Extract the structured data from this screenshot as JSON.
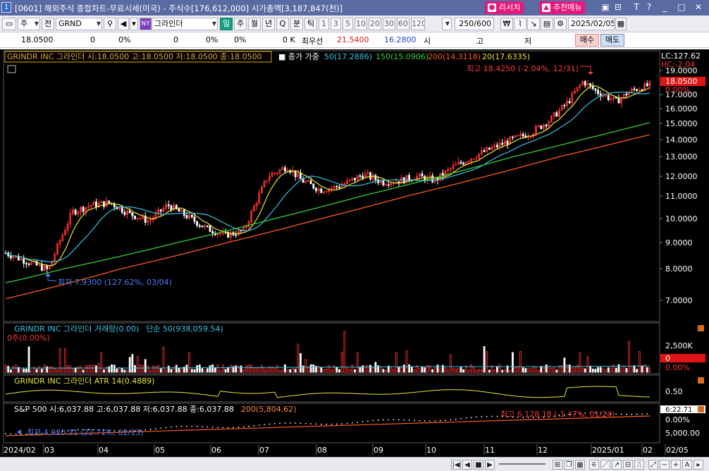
{
  "window": {
    "number": "1",
    "title": "[0601] 해외주식 종합차트-무료시세(미국) - 주식수[176,612,000] 시가총액[3,187,847(천)]",
    "research_label": "리서치",
    "menu_label": "추천메뉴",
    "controls": [
      "▣",
      "⊟",
      "T",
      "?",
      "_",
      "□",
      "✕"
    ]
  },
  "toolbar": {
    "period_type": "주",
    "full_label": "전",
    "symbol": "GRND",
    "market_badge": "NY",
    "company_name": "그라인더",
    "timeframes": [
      "일",
      "주",
      "월",
      "년",
      "Q",
      "분",
      "틱"
    ],
    "selected_timeframe": "일",
    "minute_options": [
      "1",
      "3",
      "5",
      "10",
      "20",
      "30",
      "60",
      "120"
    ],
    "bars_count": "250/600",
    "date": "2025/02/05"
  },
  "quote": {
    "price": "18.0500",
    "change": "0",
    "change_pct": "0%",
    "volume": "0",
    "volume_pct": "0%",
    "turnover_pct": "0%",
    "amount": "0 K",
    "best_bid_label": "최우선",
    "best_bid": "21.5400",
    "best_ask": "16.2800",
    "open_label": "시",
    "high_label": "고",
    "low_label": "저",
    "buy_label": "매수",
    "sell_label": "매도"
  },
  "main_panel": {
    "header": "GRINDR INC  그라인더 시:18.0500 고:18.0500 저:18.0500 종:18.0500",
    "ma_label": "종가 가중",
    "ma": [
      {
        "label": "50(17.2886)",
        "color": "#37c4e6"
      },
      {
        "label": "150(15.0906)",
        "color": "#33d13a"
      },
      {
        "label": "200(14.3118)",
        "color": "#ff5a1f"
      },
      {
        "label": "20(17.6335)",
        "color": "#e8e634"
      }
    ],
    "lc_label": "LC:127.62",
    "hc_label": "HC:-2.04",
    "price_tag": "18.0500",
    "pct_tag": "0.00%",
    "high_annotation": "최고 18.4250 (-2.04%, 12/31)",
    "low_annotation": "최저 7.9300 (127.62%, 03/04)",
    "y_ticks": [
      "19.0000",
      "18.0000",
      "17.0000",
      "16.0000",
      "15.0000",
      "14.0000",
      "13.0000",
      "12.0000",
      "11.0000",
      "10.0000",
      "9.0000",
      "8.0000",
      "7.0000"
    ]
  },
  "volume_panel": {
    "header_name": "GRINDR INC  그라인더 거래량(0.00)",
    "header_ma": "단순 50(938,059.54)",
    "sub": "0주(0.00%)",
    "y_ticks": [
      "2,500K",
      "0",
      "0.00%"
    ]
  },
  "atr_panel": {
    "header": "GRINDR INC  그라인더 ATR 14(0.4889)",
    "y_ticks": [
      "0.50"
    ]
  },
  "sp_panel": {
    "header": "S&P 500 시:6,037.88 고:6,037.88 저:6,037.88 종:6,037.88",
    "ma_label": "200(5,804.62)",
    "high_annotation": "최고 6,128.18 (-1.47%, 01/24)",
    "low_annotation": "최저 4,920.31 (22.71%, 02/13)",
    "tag_top": "6:22.71",
    "pct_tag": "0.00%",
    "y_ticks": [
      "5,000.00"
    ]
  },
  "x_axis": [
    "2024/02",
    "03",
    "04",
    "05",
    "06",
    "07",
    "08",
    "09",
    "10",
    "11",
    "12",
    "2025/01",
    "02",
    "02/05"
  ],
  "colors": {
    "ma20": "#e8e634",
    "ma50": "#37c4e6",
    "ma150": "#33d13a",
    "ma200": "#ff5a1f",
    "up_candle": "#ff3333",
    "down_candle": "#ffffff",
    "tag_red": "#e01414"
  },
  "chart_data": {
    "type": "candlestick",
    "series": [
      {
        "name": "GRINDR INC 그라인더",
        "dates": [
          "2024/02",
          "2024/03",
          "2024/04",
          "2024/05",
          "2024/06",
          "2024/07",
          "2024/08",
          "2024/09",
          "2024/10",
          "2024/11",
          "2024/12",
          "2025/01",
          "2025/02/05"
        ],
        "close": [
          8.5,
          8.2,
          10.7,
          10.1,
          9.4,
          12.3,
          11.4,
          12.0,
          11.9,
          13.9,
          15.5,
          17.2,
          18.05
        ]
      }
    ],
    "high": {
      "value": 18.425,
      "date": "12/31"
    },
    "low": {
      "value": 7.93,
      "date": "03/04"
    },
    "ylim": [
      6.5,
      19.3
    ]
  }
}
